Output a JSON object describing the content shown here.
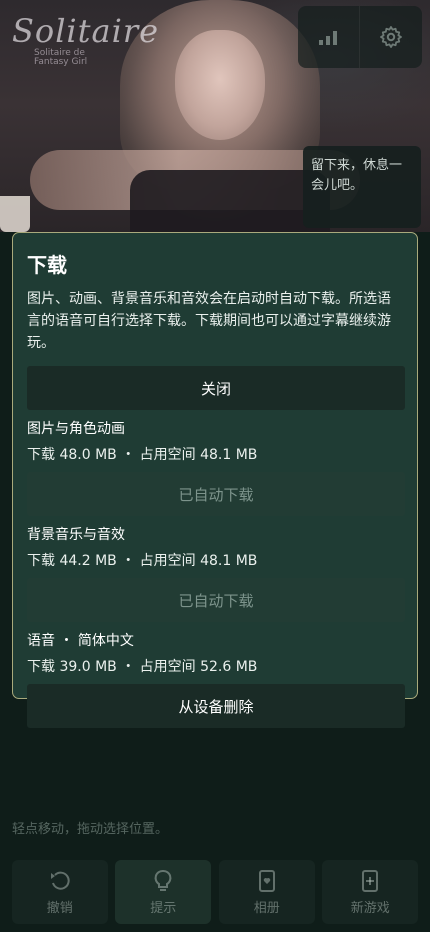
{
  "app": {
    "logo_title": "Solitaire",
    "logo_subtitle_line1": "Solitaire de",
    "logo_subtitle_line2": "Fantasy Girl"
  },
  "speech_bubble": "留下来，休息一会儿吧。",
  "modal": {
    "title": "下载",
    "description": "图片、动画、背景音乐和音效会在启动时自动下载。所选语言的语音可自行选择下载。下载期间也可以通过字幕继续游玩。",
    "close_label": "关闭",
    "sections": [
      {
        "title": "图片与角色动画",
        "info": "下载 48.0 MB ・ 占用空间 48.1 MB",
        "button": "已自动下载"
      },
      {
        "title": "背景音乐与音效",
        "info": "下载 44.2 MB ・ 占用空间 48.1 MB",
        "button": "已自动下载"
      },
      {
        "title": "语音 ・ 简体中文",
        "info": "下载 39.0 MB ・ 占用空间 52.6 MB",
        "button": "从设备删除"
      }
    ]
  },
  "hint": "轻点移动，拖动选择位置。",
  "bottom_bar": {
    "undo": "撤销",
    "hint": "提示",
    "album": "相册",
    "new_game": "新游戏"
  },
  "icons": {
    "signal": "signal-bars-icon",
    "settings": "gear-icon",
    "undo": "undo-icon",
    "hint": "lightbulb-icon",
    "album": "card-heart-icon",
    "new_game": "card-plus-icon"
  },
  "colors": {
    "modal_bg": "#1f3c34",
    "modal_border": "#a9aa7c",
    "button_dark": "#1a2b26",
    "button_disabled_text": "#7d948c"
  }
}
